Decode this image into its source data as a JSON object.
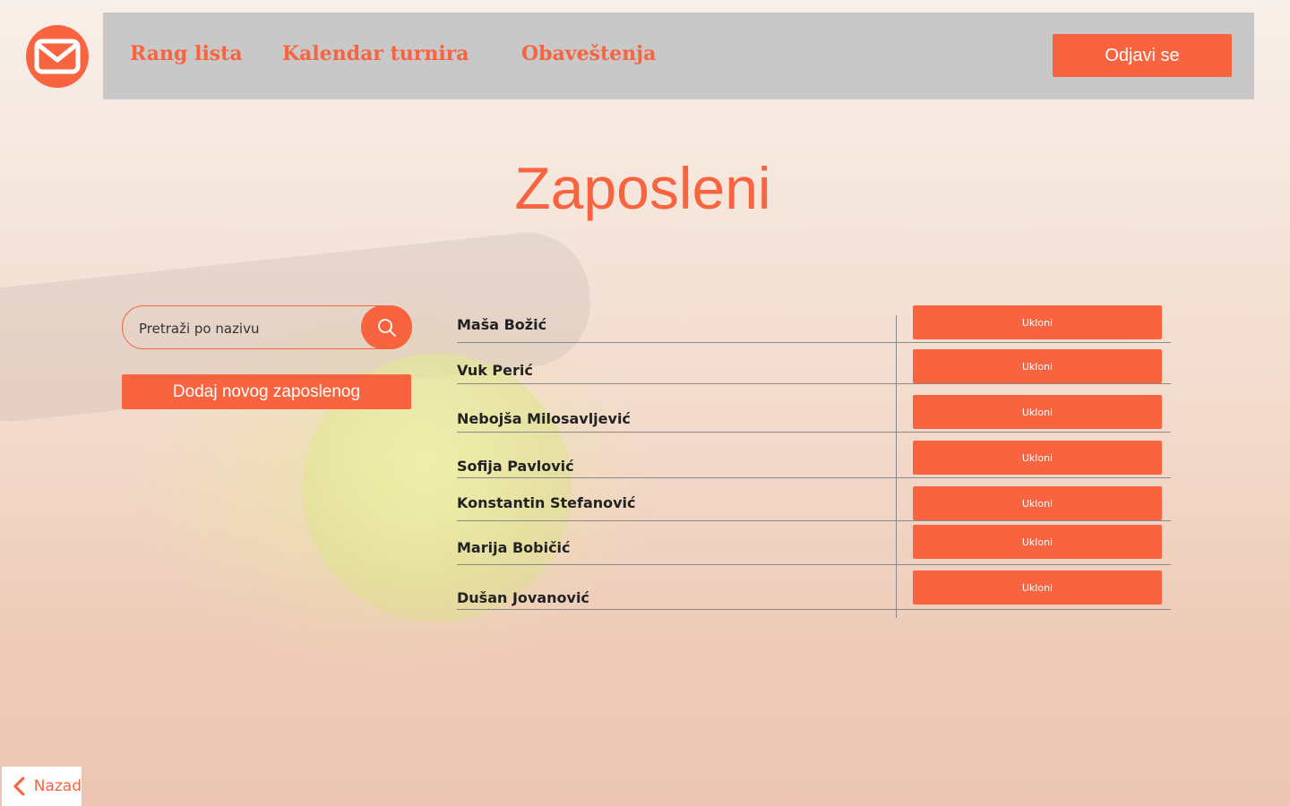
{
  "colors": {
    "accent": "#f7643f",
    "navbar_bg": "#c8c8c8",
    "text_dark": "#222222"
  },
  "logo": {
    "icon": "envelope-icon"
  },
  "nav": {
    "items": [
      {
        "label": "Rang lista"
      },
      {
        "label": "Kalendar turnira"
      },
      {
        "label": "Obaveštenja"
      }
    ],
    "logout_label": "Odjavi se"
  },
  "page": {
    "title": "Zaposleni"
  },
  "search": {
    "placeholder": "Pretraži po nazivu",
    "icon": "search-icon"
  },
  "add_button_label": "Dodaj novog zaposlenog",
  "employees": [
    {
      "name": "Maša Božić",
      "action": "Ukloni"
    },
    {
      "name": "Vuk Perić",
      "action": "Ukloni"
    },
    {
      "name": "Nebojša Milosavljević",
      "action": "Ukloni"
    },
    {
      "name": "Sofija Pavlović",
      "action": "Ukloni"
    },
    {
      "name": "Konstantin Stefanović",
      "action": "Ukloni"
    },
    {
      "name": "Marija Bobičić",
      "action": "Ukloni"
    },
    {
      "name": "Dušan Jovanović",
      "action": "Ukloni"
    }
  ],
  "back": {
    "label": "Nazad",
    "icon": "chevron-left-icon"
  }
}
